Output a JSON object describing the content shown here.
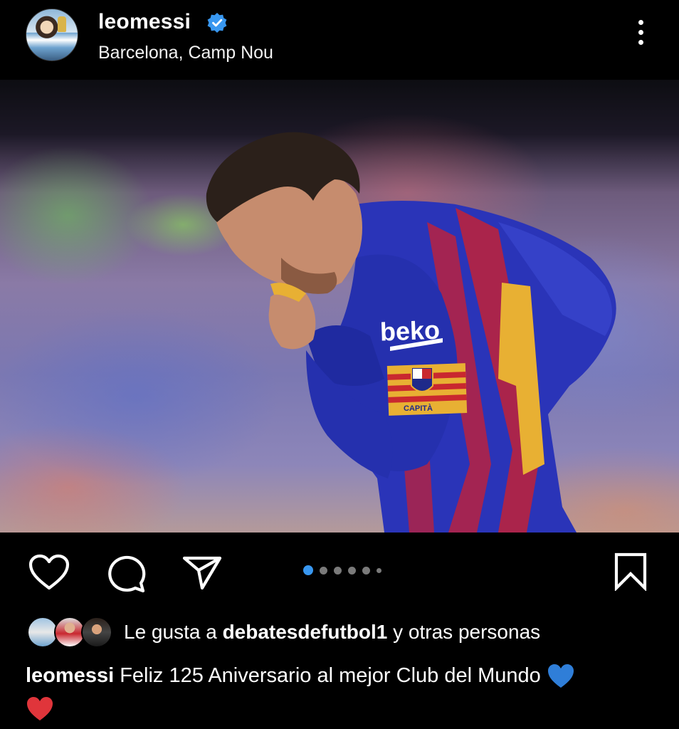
{
  "post": {
    "username": "leomessi",
    "verified": true,
    "location": "Barcelona, Camp Nou",
    "avatar": "profile-photo-with-trophy",
    "media": {
      "description_icon": "photo-player-kissing-shirt",
      "carousel_total_dots": 6,
      "carousel_active_index": 0
    },
    "jersey_text": {
      "sponsor": "beko",
      "armband": "CAPITÀ"
    },
    "icons": {
      "like": "heart-outline-icon",
      "comment": "speech-bubble-icon",
      "share": "paper-plane-icon",
      "save": "bookmark-icon",
      "more": "three-dots-vertical-icon"
    },
    "likes": {
      "prefix": "Le gusta a",
      "user": "debatesdefutbol1",
      "suffix": "y otras personas"
    },
    "caption": {
      "username": "leomessi",
      "text": "Feliz 125 Aniversario al mejor Club del Mundo",
      "emojis": [
        "blue-heart",
        "red-heart"
      ]
    },
    "colors": {
      "background": "#000000",
      "verified_blue": "#3897f0",
      "active_dot": "#3897f0",
      "inactive_dot": "#7a7a7a",
      "blue_heart": "#2f7ed8",
      "red_heart": "#e0353b"
    }
  }
}
